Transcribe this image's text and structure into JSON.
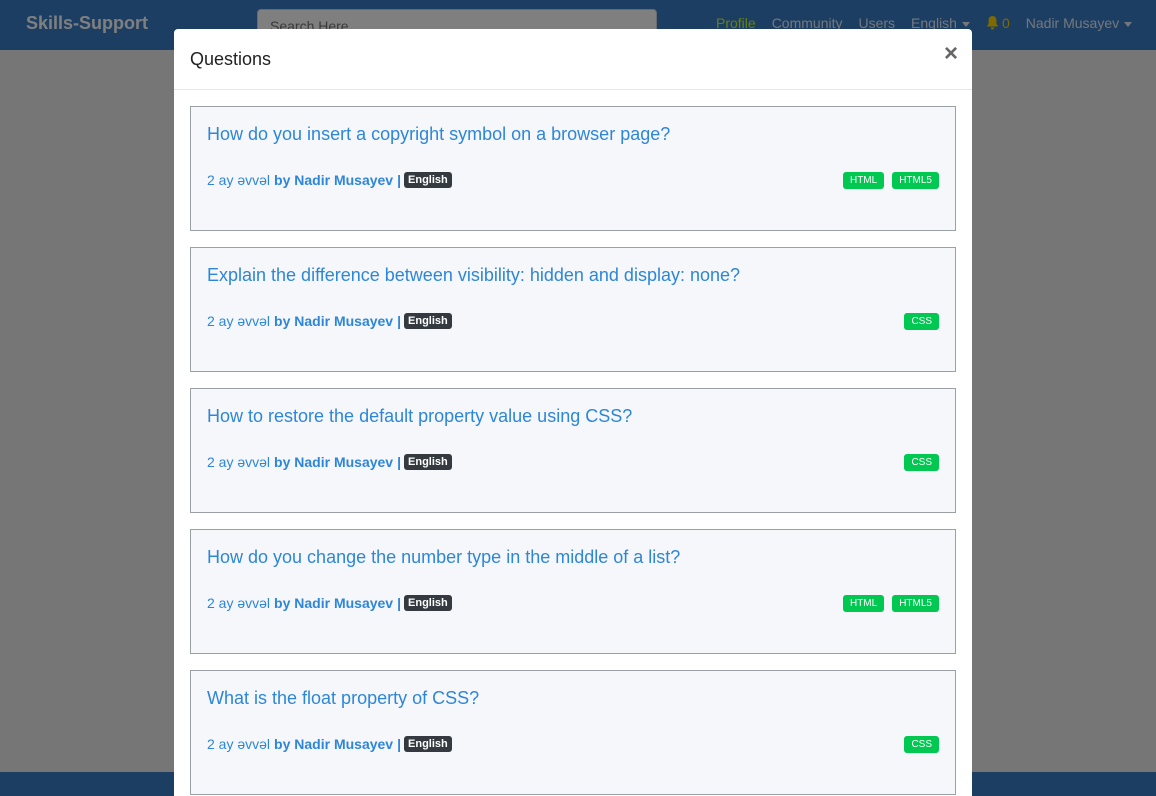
{
  "navbar": {
    "brand": "Skills-Support",
    "search_placeholder": "Search Here...",
    "links": {
      "profile": "Profile",
      "community": "Community",
      "users": "Users",
      "language": "English"
    },
    "notifications_count": "0",
    "user_name": "Nadir Musayev"
  },
  "modal": {
    "title": "Questions",
    "close": "×",
    "questions": [
      {
        "title": "How do you insert a copyright symbol on a browser page?",
        "time": "2 ay əvvəl",
        "by": "by Nadir Musayev",
        "sep": "|",
        "language": "English",
        "tags": [
          "HTML",
          "HTML5"
        ]
      },
      {
        "title": "Explain the difference between visibility: hidden and display: none?",
        "time": "2 ay əvvəl",
        "by": "by Nadir Musayev",
        "sep": "|",
        "language": "English",
        "tags": [
          "CSS"
        ]
      },
      {
        "title": "How to restore the default property value using CSS?",
        "time": "2 ay əvvəl",
        "by": "by Nadir Musayev",
        "sep": "|",
        "language": "English",
        "tags": [
          "CSS"
        ]
      },
      {
        "title": "How do you change the number type in the middle of a list?",
        "time": "2 ay əvvəl",
        "by": "by Nadir Musayev",
        "sep": "|",
        "language": "English",
        "tags": [
          "HTML",
          "HTML5"
        ]
      },
      {
        "title": "What is the float property of CSS?",
        "time": "2 ay əvvəl",
        "by": "by Nadir Musayev",
        "sep": "|",
        "language": "English",
        "tags": [
          "CSS"
        ]
      }
    ]
  },
  "colors": {
    "navbar": "#3b7dc6",
    "link": "#2e86d8",
    "tag": "#00c851",
    "lang_badge": "#343a40",
    "active_link": "#c6ff2e"
  }
}
